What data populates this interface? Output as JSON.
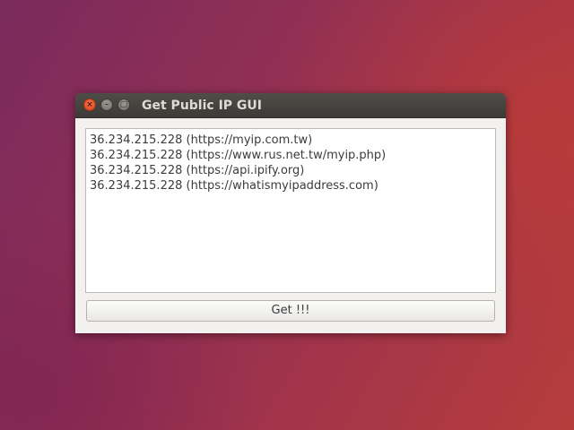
{
  "window": {
    "title": "Get Public IP GUI",
    "controls": {
      "close_icon": "close-icon",
      "minimize_icon": "minimize-icon",
      "maximize_icon": "maximize-icon"
    }
  },
  "output": {
    "lines": [
      "36.234.215.228 (https://myip.com.tw)",
      "36.234.215.228 (https://www.rus.net.tw/myip.php)",
      "36.234.215.228 (https://api.ipify.org)",
      "36.234.215.228 (https://whatismyipaddress.com)"
    ]
  },
  "actions": {
    "get_label": "Get !!!"
  },
  "colors": {
    "close_button": "#e2532c",
    "titlebar": "#3c3b37",
    "window_background": "#f2f1f0"
  }
}
